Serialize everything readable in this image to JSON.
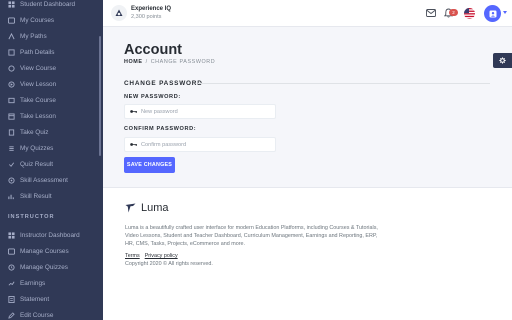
{
  "sidebar": {
    "items": [
      {
        "label": "Student Dashboard",
        "icon": "dashboard-icon"
      },
      {
        "label": "My Courses",
        "icon": "courses-icon"
      },
      {
        "label": "My Paths",
        "icon": "paths-icon"
      },
      {
        "label": "Path Details",
        "icon": "path-details-icon"
      },
      {
        "label": "View Course",
        "icon": "view-course-icon"
      },
      {
        "label": "View Lesson",
        "icon": "view-lesson-icon"
      },
      {
        "label": "Take Course",
        "icon": "take-course-icon"
      },
      {
        "label": "Take Lesson",
        "icon": "take-lesson-icon"
      },
      {
        "label": "Take Quiz",
        "icon": "quiz-icon"
      },
      {
        "label": "My Quizzes",
        "icon": "my-quizzes-icon"
      },
      {
        "label": "Quiz Result",
        "icon": "quiz-result-icon"
      },
      {
        "label": "Skill Assessment",
        "icon": "skill-assessment-icon"
      },
      {
        "label": "Skill Result",
        "icon": "skill-result-icon"
      }
    ],
    "instructor_label": "INSTRUCTOR",
    "instructor_items": [
      {
        "label": "Instructor Dashboard",
        "icon": "instructor-dashboard-icon"
      },
      {
        "label": "Manage Courses",
        "icon": "manage-courses-icon"
      },
      {
        "label": "Manage Quizzes",
        "icon": "manage-quizzes-icon"
      },
      {
        "label": "Earnings",
        "icon": "earnings-icon"
      },
      {
        "label": "Statement",
        "icon": "statement-icon"
      },
      {
        "label": "Edit Course",
        "icon": "edit-course-icon"
      }
    ]
  },
  "topbar": {
    "brand_title": "Experience IQ",
    "brand_points": "2,300 points",
    "notification_count": "2"
  },
  "page": {
    "title": "Account",
    "breadcrumb_home": "HOME",
    "breadcrumb_sep": "/",
    "breadcrumb_current": "CHANGE PASSWORD"
  },
  "form": {
    "section_title": "CHANGE PASSWORD",
    "new_password_label": "NEW PASSWORD:",
    "new_password_placeholder": "New password",
    "new_password_value": "",
    "confirm_password_label": "CONFIRM PASSWORD:",
    "confirm_password_placeholder": "Confirm password",
    "confirm_password_value": "",
    "save_label": "SAVE CHANGES"
  },
  "footer": {
    "brand": "Luma",
    "description": "Luma is a beautifully crafted user interface for modern Education Platforms, including Courses & Tutorials, Video Lessons, Student and Teacher Dashboard, Curriculum Management, Earnings and Reporting, ERP, HR, CMS, Tasks, Projects, eCommerce and more.",
    "terms": "Terms",
    "privacy": "Privacy policy",
    "copyright": "Copyright 2020 © All rights reserved."
  },
  "colors": {
    "sidebar_bg": "#303956",
    "accent": "#5567ff",
    "badge": "#d9534f"
  }
}
